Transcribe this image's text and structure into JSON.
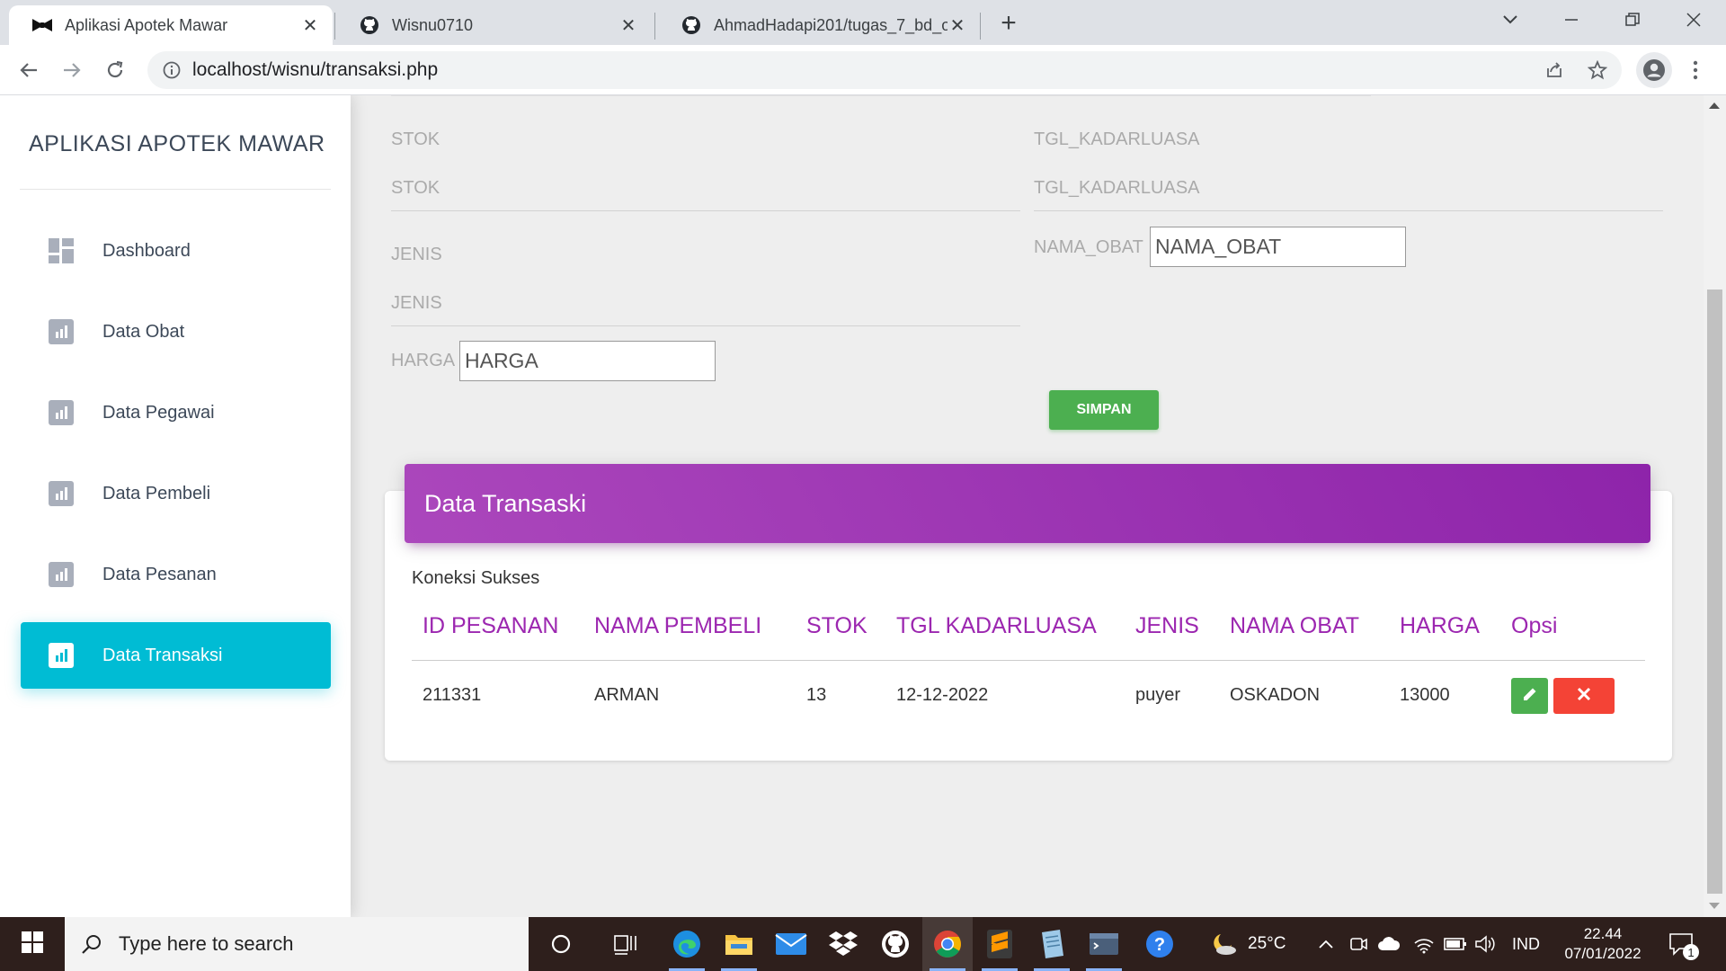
{
  "browser": {
    "tabs": [
      {
        "title": "Aplikasi Apotek Mawar",
        "active": true
      },
      {
        "title": "Wisnu0710",
        "active": false
      },
      {
        "title": "AhmadHadapi201/tugas_7_bd_o",
        "active": false
      }
    ],
    "url": "localhost/wisnu/transaksi.php"
  },
  "sidebar": {
    "brand": "APLIKASI APOTEK MAWAR",
    "items": [
      {
        "label": "Dashboard",
        "icon": "dashboard-icon",
        "active": false
      },
      {
        "label": "Data Obat",
        "icon": "chart-icon",
        "active": false
      },
      {
        "label": "Data Pegawai",
        "icon": "chart-icon",
        "active": false
      },
      {
        "label": "Data Pembeli",
        "icon": "chart-icon",
        "active": false
      },
      {
        "label": "Data Pesanan",
        "icon": "chart-icon",
        "active": false
      },
      {
        "label": "Data Transaksi",
        "icon": "chart-icon",
        "active": true
      }
    ]
  },
  "form": {
    "stok_label": "STOK",
    "stok_placeholder": "STOK",
    "tgl_label": "TGL_KADARLUASA",
    "tgl_placeholder": "TGL_KADARLUASA",
    "jenis_label": "JENIS",
    "jenis_placeholder": "JENIS",
    "nama_obat_label": "NAMA_OBAT",
    "nama_obat_value": "NAMA_OBAT",
    "harga_label": "HARGA",
    "harga_value": "HARGA",
    "submit_label": "SIMPAN"
  },
  "transaksi": {
    "title": "Data Transaski",
    "status": "Koneksi Sukses",
    "columns": [
      "ID PESANAN",
      "NAMA PEMBELI",
      "STOK",
      "TGL KADARLUASA",
      "JENIS",
      "NAMA OBAT",
      "HARGA",
      "Opsi"
    ],
    "rows": [
      {
        "id_pesanan": "211331",
        "nama_pembeli": "ARMAN",
        "stok": "13",
        "tgl_kadarluasa": "12-12-2022",
        "jenis": "puyer",
        "nama_obat": "OSKADON",
        "harga": "13000"
      }
    ]
  },
  "taskbar": {
    "search_placeholder": "Type here to search",
    "temperature": "25°C",
    "language": "IND",
    "time": "22.44",
    "date": "07/01/2022",
    "notification_count": "1"
  },
  "colors": {
    "accent_cyan": "#00bcd4",
    "header_purple": "#9c27b0",
    "save_green": "#4caf50",
    "delete_red": "#f44336"
  }
}
